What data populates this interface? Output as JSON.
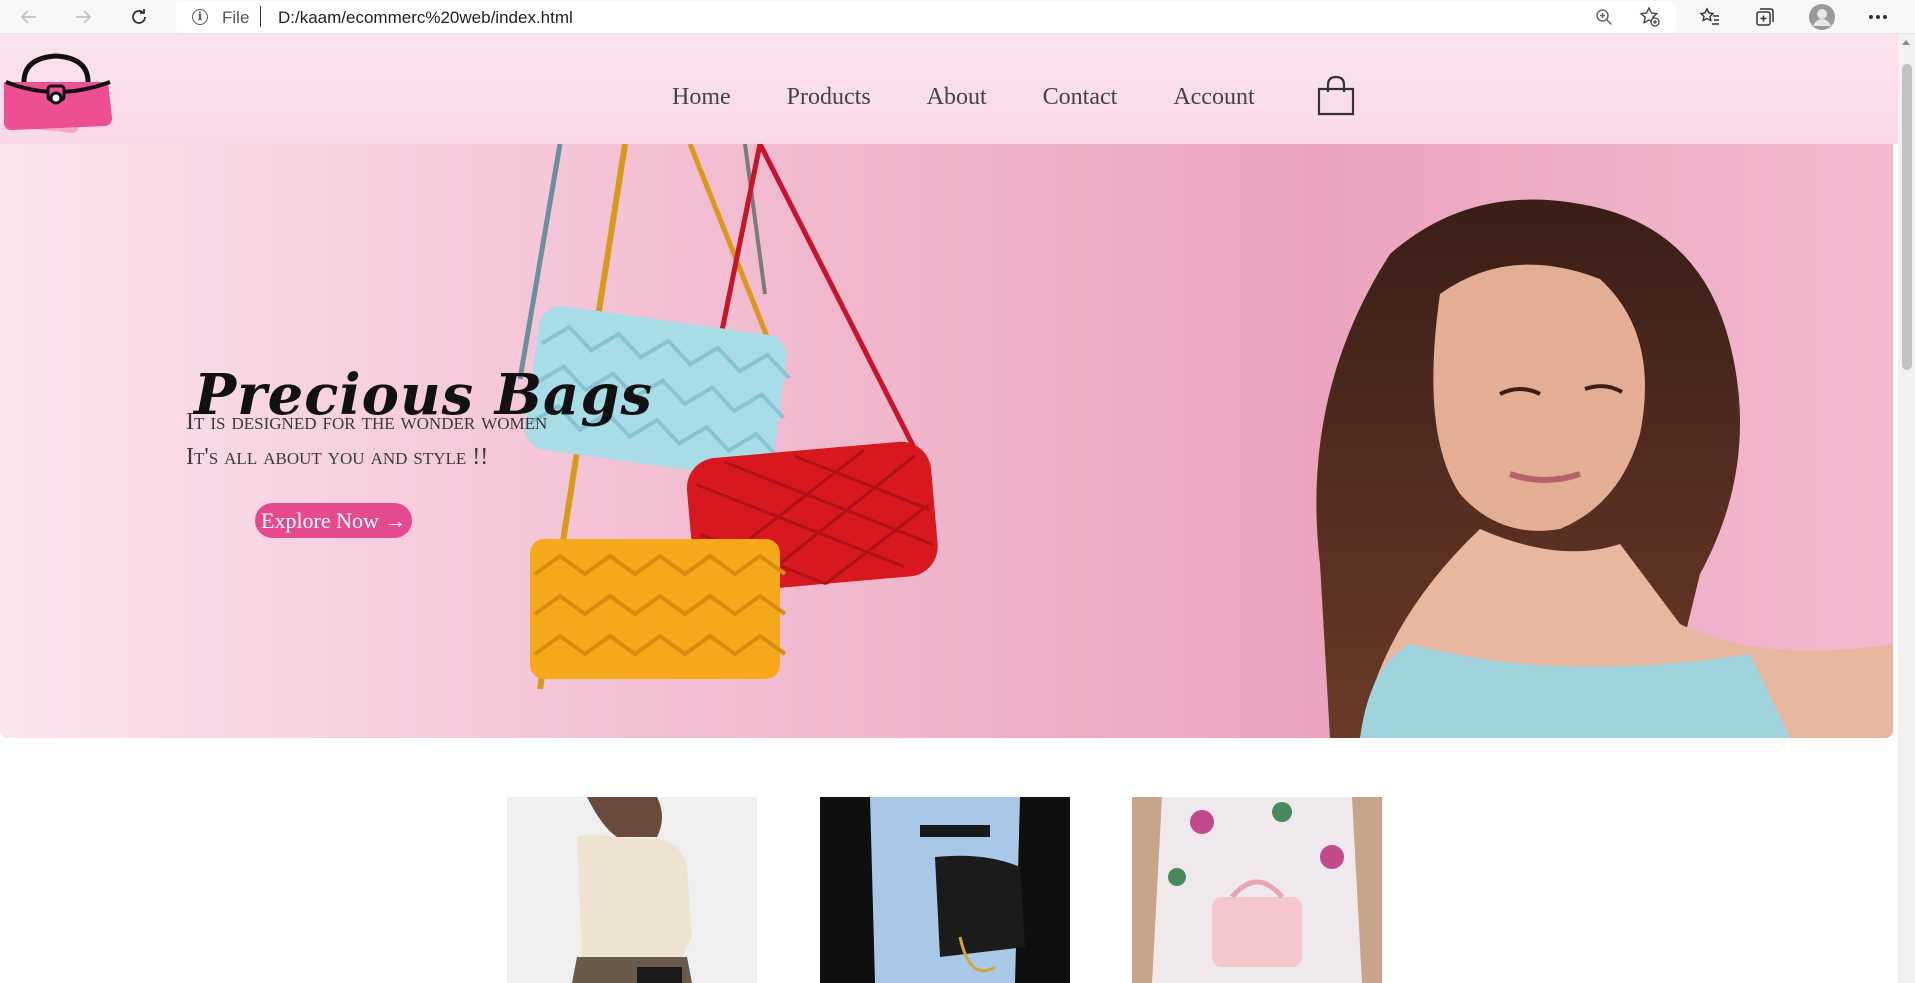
{
  "browser": {
    "address_scheme": "File",
    "address_url": "D:/kaam/ecommerc%20web/index.html",
    "icons": [
      "back-icon",
      "forward-icon",
      "reload-icon",
      "site-info-icon",
      "zoom-icon",
      "add-favorite-icon",
      "favorites-icon",
      "collections-icon",
      "profile-icon",
      "more-icon"
    ]
  },
  "header": {
    "logo_icon": "handbag-logo-icon",
    "nav": [
      {
        "label": "Home"
      },
      {
        "label": "Products"
      },
      {
        "label": "About"
      },
      {
        "label": "Contact"
      },
      {
        "label": "Account"
      }
    ],
    "cart_icon": "shopping-bag-icon"
  },
  "hero": {
    "title": "Precious Bags",
    "subtitle_line1": "It is designed for the wonder women",
    "subtitle_line2": "It's all about you and style !!",
    "cta_label": "Explore Now →"
  },
  "colors": {
    "header_bg": "#fbe3ee",
    "hero_bg": "#f1b7cd",
    "cta_bg": "#e64a8e",
    "nav_text": "#444444"
  }
}
